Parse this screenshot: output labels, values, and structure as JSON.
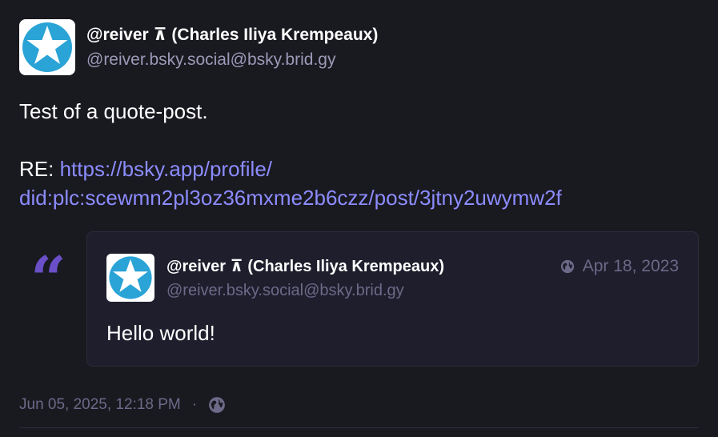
{
  "post": {
    "author": {
      "display_name": "@reiver ⊼ (Charles Iliya Krempeaux)",
      "handle": "@reiver.bsky.social@bsky.brid.gy",
      "avatar_icon": "star-badge-icon"
    },
    "content": {
      "line1": "Test of a quote-post.",
      "re_prefix": "RE: ",
      "link_line1": "https://bsky.app/profile/",
      "link_line2": "did:plc:scewmn2pl3oz36mxme2b6czz/post/3jtny2uwymw2f"
    },
    "quote": {
      "mark_icon": "quote-icon",
      "author": {
        "display_name": "@reiver ⊼ (Charles Iliya Krempeaux)",
        "handle": "@reiver.bsky.social@bsky.brid.gy",
        "avatar_icon": "star-badge-icon"
      },
      "visibility_icon": "globe-icon",
      "date": "Apr 18, 2023",
      "text": "Hello world!"
    },
    "footer": {
      "timestamp": "Jun 05, 2025, 12:18 PM",
      "separator": "·",
      "visibility_icon": "globe-icon"
    }
  },
  "colors": {
    "background": "#191920",
    "link": "#8c8cff",
    "quote_accent": "#6a4fc7",
    "avatar_blue": "#2aa3d6"
  }
}
